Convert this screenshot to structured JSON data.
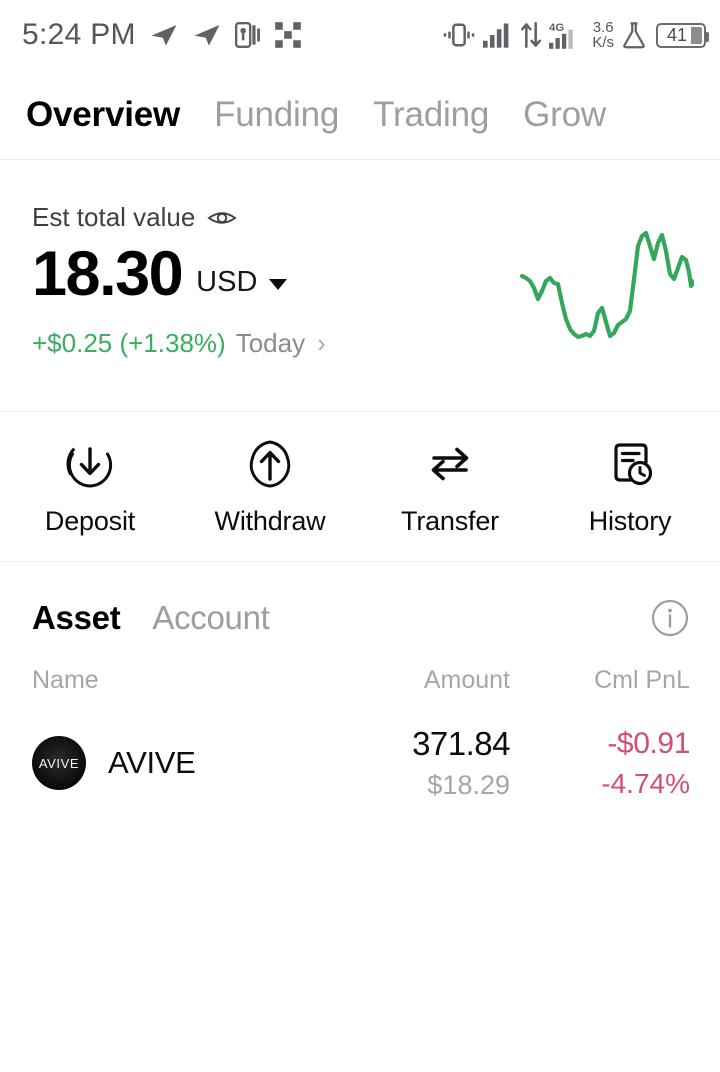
{
  "statusbar": {
    "time": "5:24 PM",
    "icons_left": [
      "telegram-plane-icon",
      "telegram-plane-icon",
      "app-p-icon",
      "pixel-squares-icon"
    ],
    "icons_right": [
      "vibrate-icon",
      "signal-bars-icon",
      "data-transfer-icon",
      "4g-signal-icon",
      "flask-icon"
    ],
    "network_type": "4G",
    "data_speed_value": "3.6",
    "data_speed_unit": "K/s",
    "battery_percent": "41"
  },
  "top_tabs": [
    {
      "label": "Overview",
      "active": true
    },
    {
      "label": "Funding",
      "active": false
    },
    {
      "label": "Trading",
      "active": false
    },
    {
      "label": "Grow",
      "active": false
    }
  ],
  "balance": {
    "est_label": "Est total value",
    "eye_icon": "eye-icon",
    "value": "18.30",
    "currency": "USD",
    "currency_caret": "caret-down-icon",
    "change_value": "+$0.25 (+1.38%)",
    "change_period": "Today",
    "chevron": "›",
    "positive_color": "#3aae5f"
  },
  "chart_data": {
    "type": "line",
    "title": "",
    "xlabel": "",
    "ylabel": "",
    "series": [
      {
        "name": "Est total value",
        "color": "#33a85c",
        "values": [
          62,
          60,
          58,
          52,
          44,
          50,
          58,
          60,
          57,
          56,
          40,
          26,
          18,
          14,
          12,
          13,
          14,
          13,
          16,
          30,
          34,
          24,
          14,
          16,
          22,
          24,
          26,
          32,
          56,
          84,
          92,
          94,
          84,
          74,
          86,
          92,
          80,
          62,
          58,
          66,
          74,
          72,
          62,
          52,
          56,
          52
        ]
      }
    ],
    "ylim": [
      0,
      100
    ],
    "grid": false,
    "legend": "none"
  },
  "actions": [
    {
      "label": "Deposit",
      "icon": "deposit-arrow-down-icon"
    },
    {
      "label": "Withdraw",
      "icon": "withdraw-arrow-up-icon"
    },
    {
      "label": "Transfer",
      "icon": "transfer-arrows-icon"
    },
    {
      "label": "History",
      "icon": "history-document-clock-icon"
    }
  ],
  "asset_section": {
    "tabs": [
      {
        "label": "Asset",
        "active": true
      },
      {
        "label": "Account",
        "active": false
      }
    ],
    "info_icon": "info-circle-icon",
    "columns": {
      "name": "Name",
      "amount": "Amount",
      "pnl": "Cml PnL"
    },
    "rows": [
      {
        "logo_text": "AVIVE",
        "name": "AVIVE",
        "amount": "371.84",
        "amount_fiat": "$18.29",
        "pnl_value": "-$0.91",
        "pnl_percent": "-4.74%",
        "pnl_color": "#cf5070"
      }
    ]
  }
}
